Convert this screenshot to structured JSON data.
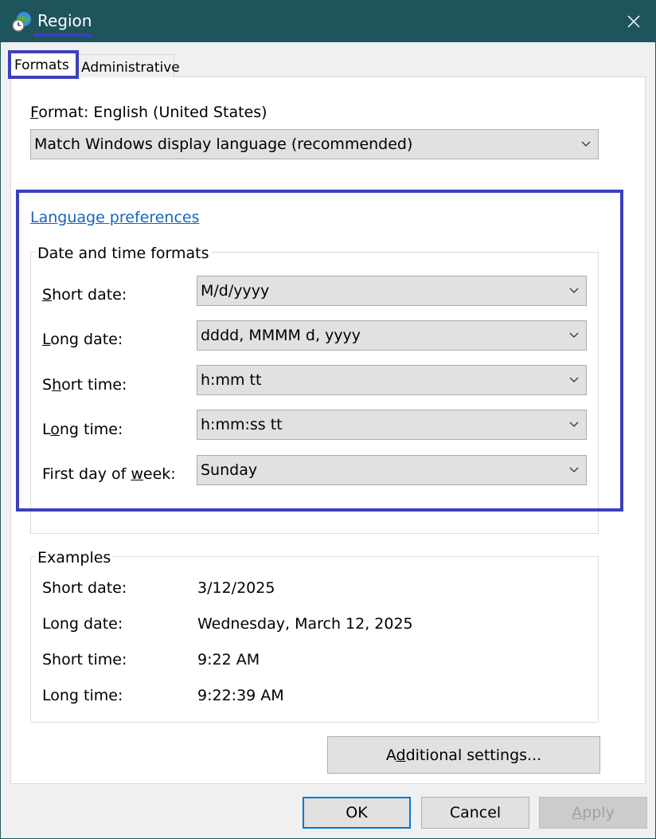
{
  "window": {
    "title": "Region",
    "icons": {
      "app": "globe-clock-icon",
      "close": "close-icon"
    }
  },
  "tabs": [
    {
      "label": "Formats",
      "selected": true
    },
    {
      "label": "Administrative",
      "selected": false
    }
  ],
  "format": {
    "label_prefix": "F",
    "label_rest": "ormat: English (United States)",
    "selected": "Match Windows display language (recommended)"
  },
  "language_preferences_link": "Language preferences",
  "date_time_formats": {
    "title": "Date and time formats",
    "rows": [
      {
        "pre": "",
        "key": "S",
        "post": "hort date:",
        "value": "M/d/yyyy"
      },
      {
        "pre": "",
        "key": "L",
        "post": "ong date:",
        "value": "dddd, MMMM d, yyyy"
      },
      {
        "pre": "S",
        "key": "h",
        "post": "ort time:",
        "value": "h:mm tt"
      },
      {
        "pre": "L",
        "key": "o",
        "post": "ng time:",
        "value": "h:mm:ss tt"
      },
      {
        "pre": "First day of ",
        "key": "w",
        "post": "eek:",
        "value": "Sunday"
      }
    ]
  },
  "examples": {
    "title": "Examples",
    "rows": [
      {
        "label": "Short date:",
        "value": "3/12/2025"
      },
      {
        "label": "Long date:",
        "value": "Wednesday, March 12, 2025"
      },
      {
        "label": "Short time:",
        "value": "9:22 AM"
      },
      {
        "label": "Long time:",
        "value": "9:22:39 AM"
      }
    ]
  },
  "additional_settings": {
    "pre": "A",
    "key": "d",
    "post": "ditional settings..."
  },
  "buttons": {
    "ok": "OK",
    "cancel": "Cancel",
    "apply_key": "A",
    "apply_rest": "pply",
    "apply_disabled": true
  },
  "colors": {
    "titlebar": "#1e555c",
    "highlight": "#3c3fbd",
    "link": "#1565c0",
    "ok_border": "#0078d7"
  }
}
